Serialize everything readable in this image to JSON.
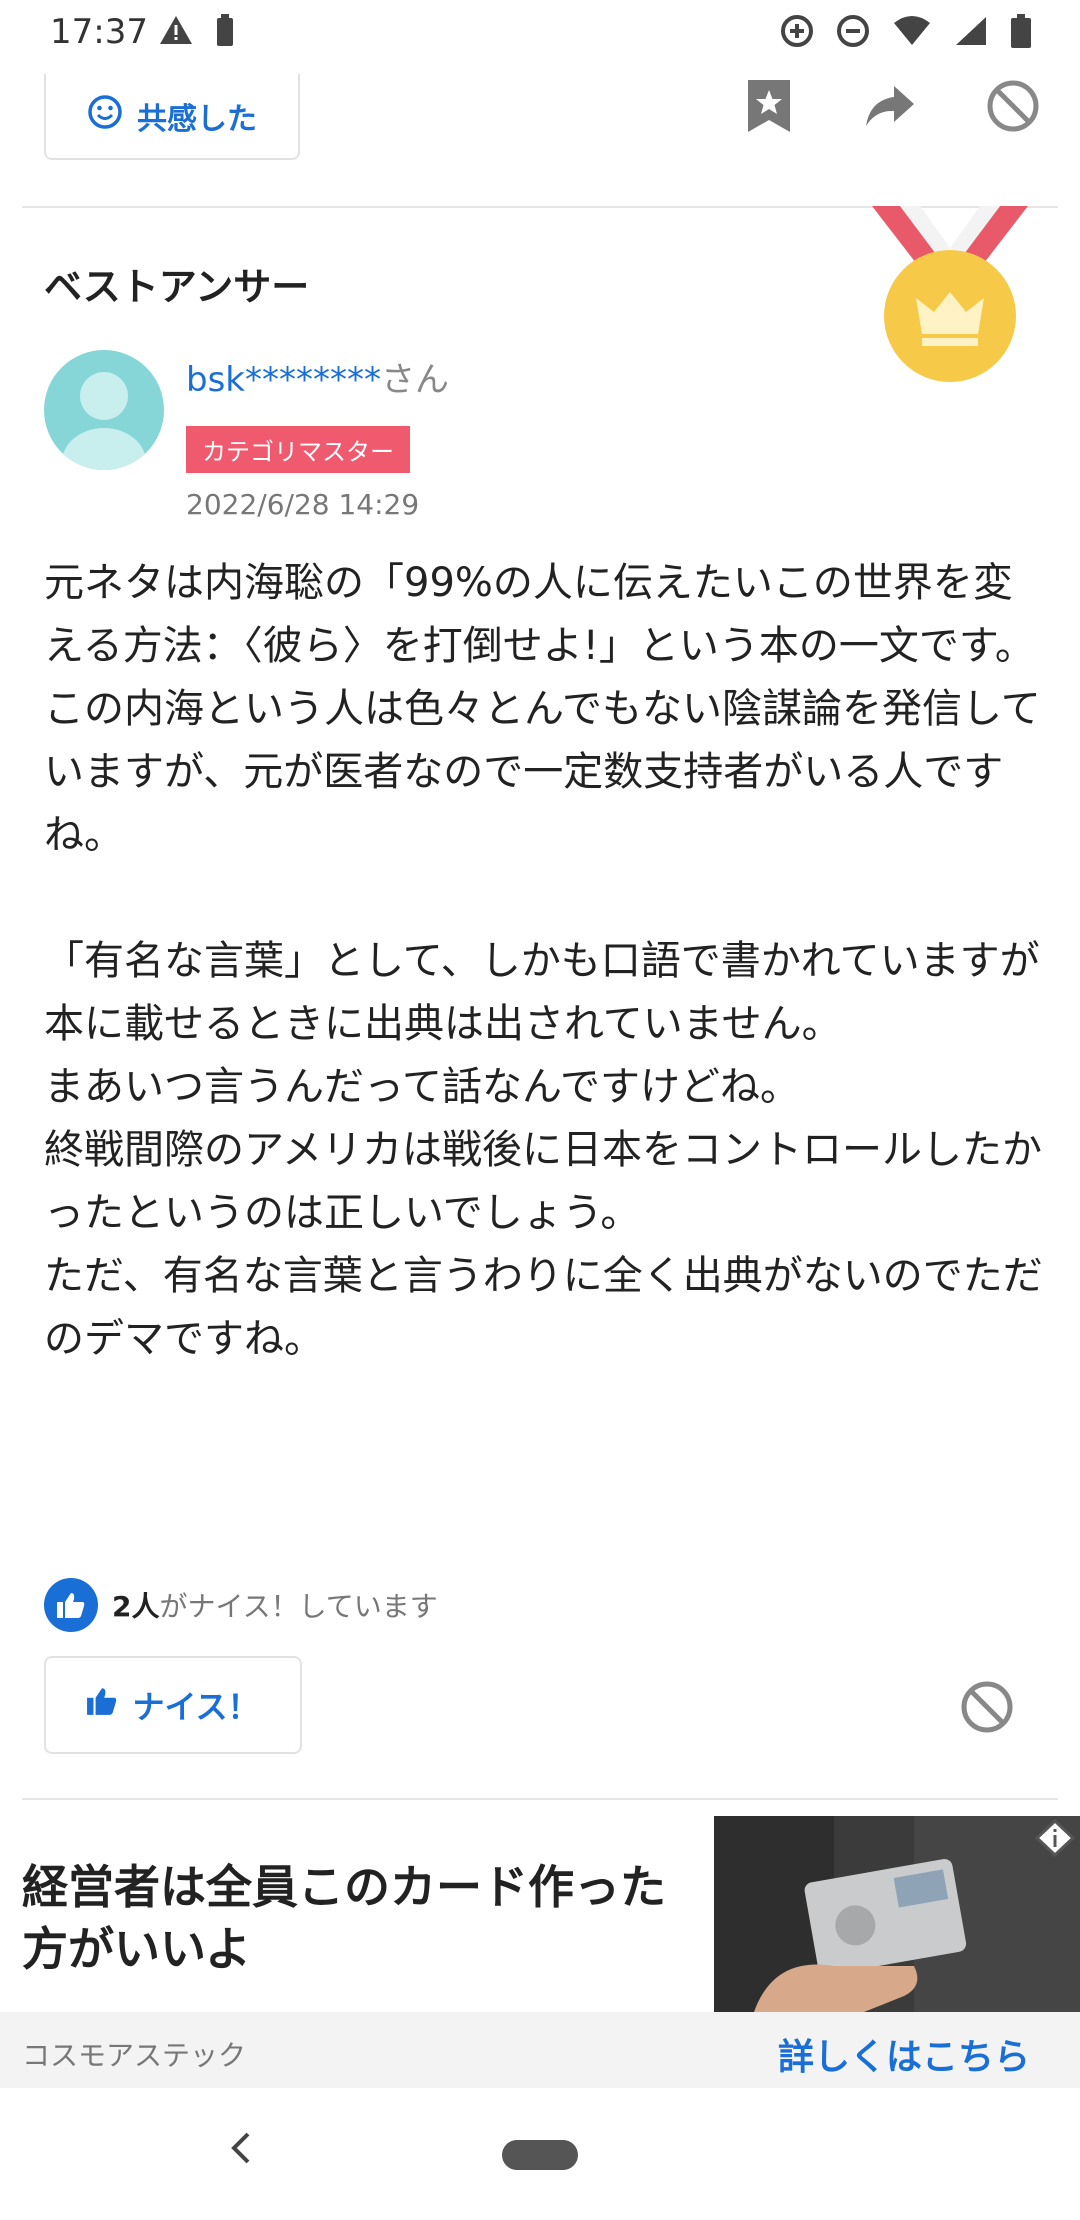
{
  "status_bar": {
    "time": "17:37"
  },
  "top_actions": {
    "sympathy_label": "共感した"
  },
  "best_answer": {
    "title": "ベストアンサー",
    "username": "bsk********",
    "honorific": "さん",
    "badge": "カテゴリマスター",
    "date": "2022/6/28 14:29",
    "paragraphs": [
      "元ネタは内海聡の「99%の人に伝えたいこの世界を変える方法：〈彼ら〉を打倒せよ!」という本の一文です。",
      "この内海という人は色々とんでもない陰謀論を発信していますが、元が医者なので一定数支持者がいる人ですね。",
      "",
      "「有名な言葉」として、しかも口語で書かれていますが本に載せるときに出典は出されていません。",
      "まあいつ言うんだって話なんですけどね。",
      "終戦間際のアメリカは戦後に日本をコントロールしたかったというのは正しいでしょう。",
      "ただ、有名な言葉と言うわりに全く出典がないのでただのデマですね。"
    ],
    "nice_count": "2人",
    "nice_count_suffix": "がナイス！しています",
    "nice_button_label": "ナイス！"
  },
  "ad": {
    "headline": "経営者は全員このカード作った方がいいよ",
    "sponsor": "コスモアステック",
    "link_label": "詳しくはこちら"
  },
  "colors": {
    "accent": "#1a6fd6",
    "badge": "#f05a6e",
    "medal_gold": "#f7c948",
    "medal_ribbon": "#e85a6a"
  }
}
